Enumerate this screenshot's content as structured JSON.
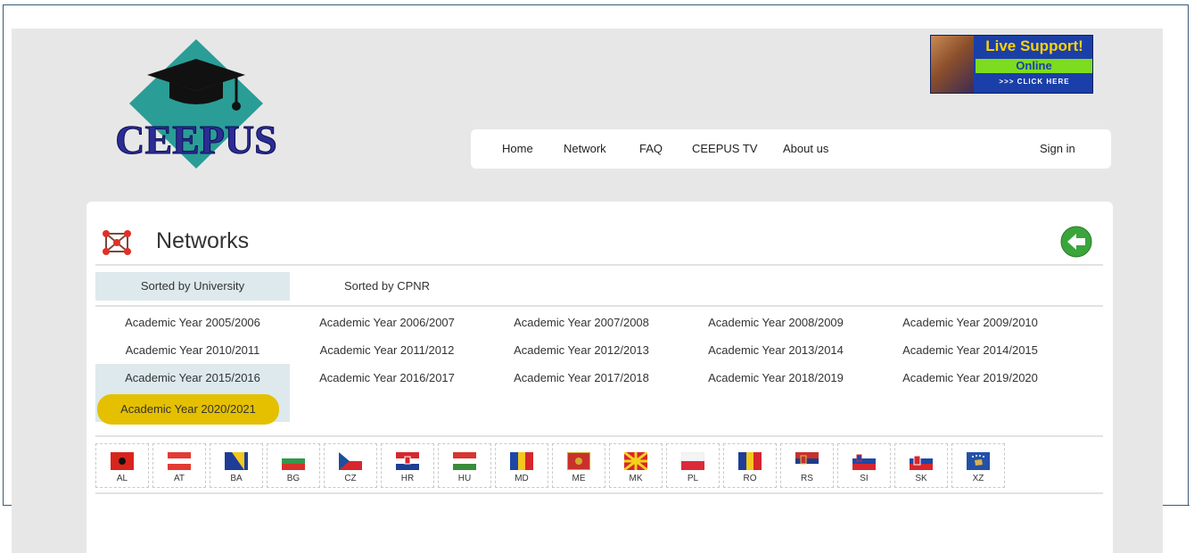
{
  "logo": {
    "text": "CEEPUS"
  },
  "live_support": {
    "title": "Live Support!",
    "status": "Online",
    "cta": ">>> CLICK HERE"
  },
  "nav": {
    "items": [
      {
        "label": "Home"
      },
      {
        "label": "Network"
      },
      {
        "label": "FAQ"
      },
      {
        "label": "CEEPUS TV"
      },
      {
        "label": "About us"
      }
    ],
    "sign_in": "Sign in"
  },
  "panel": {
    "title": "Networks"
  },
  "tabs": [
    {
      "label": "Sorted by University",
      "active": true
    },
    {
      "label": "Sorted by CPNR",
      "active": false
    }
  ],
  "academic_years": [
    "Academic Year 2005/2006",
    "Academic Year 2006/2007",
    "Academic Year 2007/2008",
    "Academic Year 2008/2009",
    "Academic Year 2009/2010",
    "Academic Year 2010/2011",
    "Academic Year 2011/2012",
    "Academic Year 2012/2013",
    "Academic Year 2013/2014",
    "Academic Year 2014/2015",
    "Academic Year 2015/2016",
    "Academic Year 2016/2017",
    "Academic Year 2017/2018",
    "Academic Year 2018/2019",
    "Academic Year 2019/2020",
    "Academic Year 2020/2021"
  ],
  "selected_year": "Academic Year 2020/2021",
  "highlight_color": "#e4c000",
  "countries": [
    "AL",
    "AT",
    "BA",
    "BG",
    "CZ",
    "HR",
    "HU",
    "MD",
    "ME",
    "MK",
    "PL",
    "RO",
    "RS",
    "SI",
    "SK",
    "XZ"
  ],
  "colors": {
    "active_tab": "#dde9ed",
    "page_bg": "#e7e7e7",
    "back_button": "#3aa53a"
  }
}
